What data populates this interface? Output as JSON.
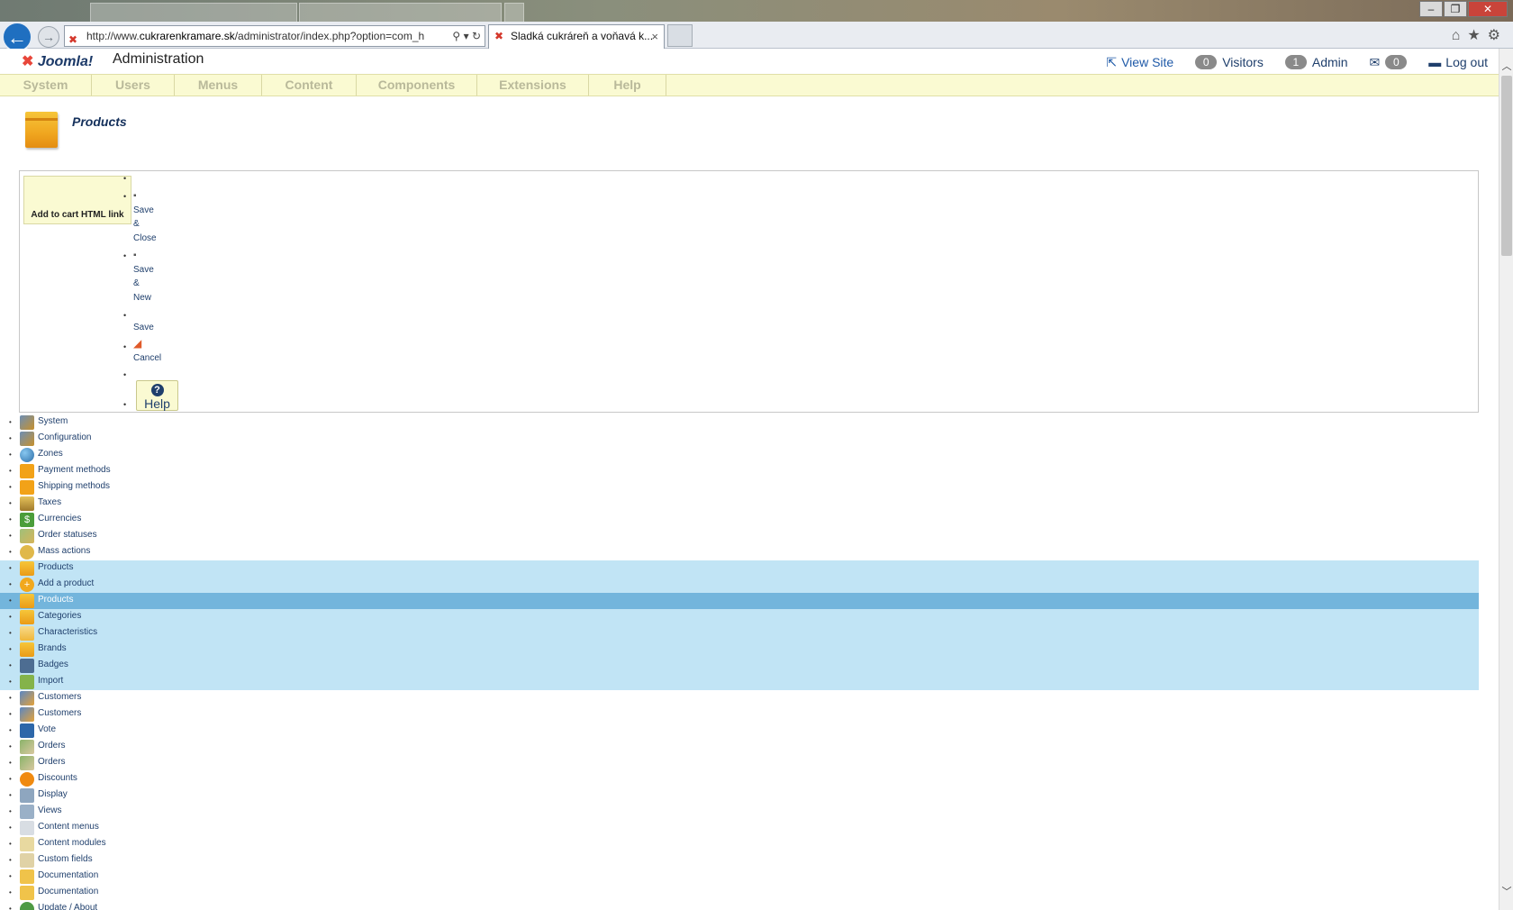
{
  "browser": {
    "url_prefix": "http://www.",
    "url_host": "cukrarenkramare.sk",
    "url_path": "/administrator/index.php?option=com_h",
    "tab_title": "Sladká cukráreň a voňavá k...",
    "tab_close": "×",
    "window_minimize": "–",
    "window_restore": "❐",
    "window_close": "✕",
    "back": "←",
    "forward": "→"
  },
  "header": {
    "brand": "Joomla!",
    "title": "Administration",
    "view_site": "View Site",
    "visitors_count": "0",
    "visitors_label": "Visitors",
    "admin_count": "1",
    "admin_label": "Admin",
    "messages_count": "0",
    "logout": "Log out"
  },
  "menu": [
    "System",
    "Users",
    "Menus",
    "Content",
    "Components",
    "Extensions",
    "Help"
  ],
  "page": {
    "title": "Products"
  },
  "toolbar": {
    "add_to_cart_link": "Add to cart HTML link",
    "save_close_1": "Save",
    "save_close_2": "&",
    "save_close_3": "Close",
    "save_new_1": "Save",
    "save_new_2": "&",
    "save_new_3": "New",
    "save": "Save",
    "cancel": "Cancel",
    "help": "Help"
  },
  "nav": [
    {
      "label": "System",
      "icon": "tools-icon"
    },
    {
      "label": "Configuration",
      "icon": "tools-icon"
    },
    {
      "label": "Zones",
      "icon": "globe-icon"
    },
    {
      "label": "Payment methods",
      "icon": "puzzle-icon"
    },
    {
      "label": "Shipping methods",
      "icon": "puzzle-icon"
    },
    {
      "label": "Taxes",
      "icon": "taxes-icon"
    },
    {
      "label": "Currencies",
      "icon": "money-icon"
    },
    {
      "label": "Order statuses",
      "icon": "status-icon"
    },
    {
      "label": "Mass actions",
      "icon": "mass-icon"
    },
    {
      "label": "Products",
      "icon": "folder-icon"
    },
    {
      "label": "Add a product",
      "icon": "plus-icon"
    },
    {
      "label": "Products",
      "icon": "folder-icon"
    },
    {
      "label": "Categories",
      "icon": "folder-icon"
    },
    {
      "label": "Characteristics",
      "icon": "chars-icon"
    },
    {
      "label": "Brands",
      "icon": "folder-icon"
    },
    {
      "label": "Badges",
      "icon": "badge-icon"
    },
    {
      "label": "Import",
      "icon": "import-icon"
    },
    {
      "label": "Customers",
      "icon": "users-icon"
    },
    {
      "label": "Customers",
      "icon": "users-icon"
    },
    {
      "label": "Vote",
      "icon": "vote-icon"
    },
    {
      "label": "Orders",
      "icon": "orders-icon"
    },
    {
      "label": "Orders",
      "icon": "orders-icon"
    },
    {
      "label": "Discounts",
      "icon": "discount-icon"
    },
    {
      "label": "Display",
      "icon": "display-icon"
    },
    {
      "label": "Views",
      "icon": "views-icon"
    },
    {
      "label": "Content menus",
      "icon": "menus-icon"
    },
    {
      "label": "Content modules",
      "icon": "modules-icon"
    },
    {
      "label": "Custom fields",
      "icon": "fields-icon"
    },
    {
      "label": "Documentation",
      "icon": "docs-icon"
    },
    {
      "label": "Documentation",
      "icon": "docs-icon"
    },
    {
      "label": "Update / About",
      "icon": "update-icon"
    }
  ],
  "colors": {
    "menu_bg": "#fafad2",
    "nav_selected": "#c1e4f5",
    "nav_active": "#73b5dc",
    "link": "#1f3f6c"
  }
}
